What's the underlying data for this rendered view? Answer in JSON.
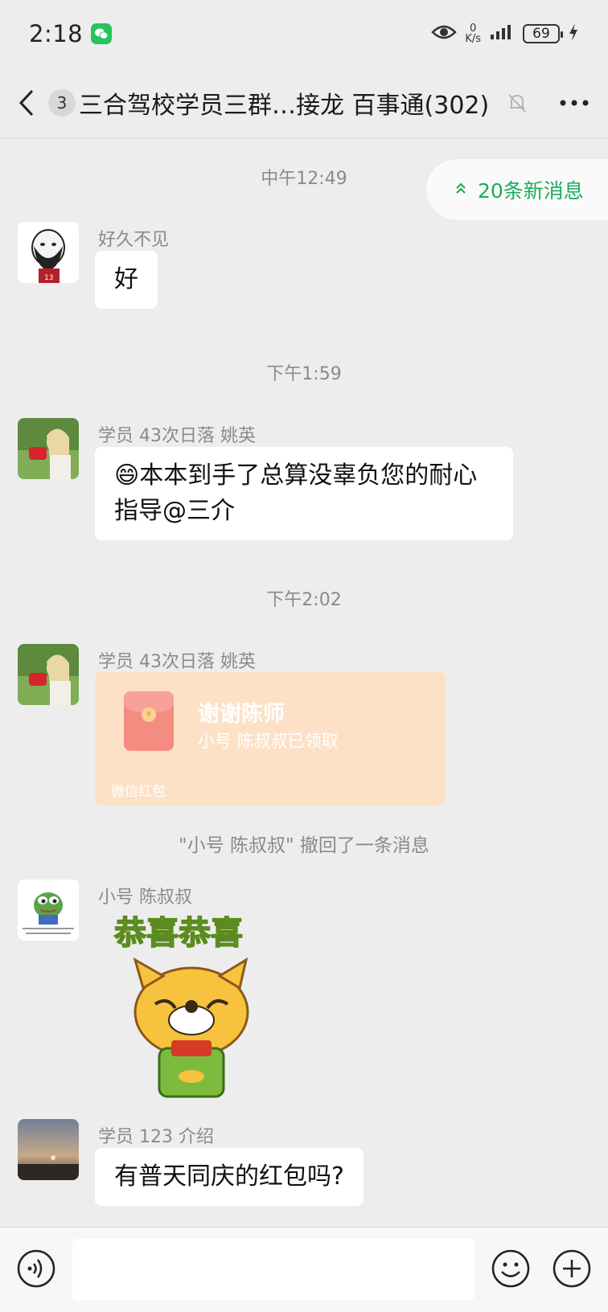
{
  "status_bar": {
    "time": "2:18",
    "net_speed_value": "0",
    "net_speed_unit": "K/s",
    "battery": "69"
  },
  "header": {
    "unread_count": "3",
    "title": "三合驾校学员三群…接龙 百事通(302)"
  },
  "new_messages_pill": {
    "label": "20条新消息"
  },
  "messages": [
    {
      "type": "time",
      "text": "中午12:49"
    },
    {
      "type": "text",
      "sender": "好久不见",
      "text": "好"
    },
    {
      "type": "time",
      "text": "下午1:59"
    },
    {
      "type": "text",
      "sender": "学员 43次日落 姚英",
      "emoji": "😄",
      "text": "本本到手了总算没辜负您的耐心指导@三介"
    },
    {
      "type": "time",
      "text": "下午2:02"
    },
    {
      "type": "red_packet",
      "sender": "学员 43次日落 姚英",
      "title": "谢谢陈师",
      "subtitle": "小号 陈叔叔已领取",
      "footer": "微信红包"
    },
    {
      "type": "system",
      "text": "\"小号 陈叔叔\" 撤回了一条消息"
    },
    {
      "type": "sticker",
      "sender": "小号 陈叔叔",
      "caption": "恭喜恭喜"
    },
    {
      "type": "text",
      "sender": "学员 123 介绍",
      "text": "有普天同庆的红包吗?"
    }
  ],
  "input_bar": {
    "placeholder": ""
  },
  "colors": {
    "background": "#ededed",
    "accent_green": "#1aad5a",
    "red_packet_bg": "#fde1c7"
  }
}
